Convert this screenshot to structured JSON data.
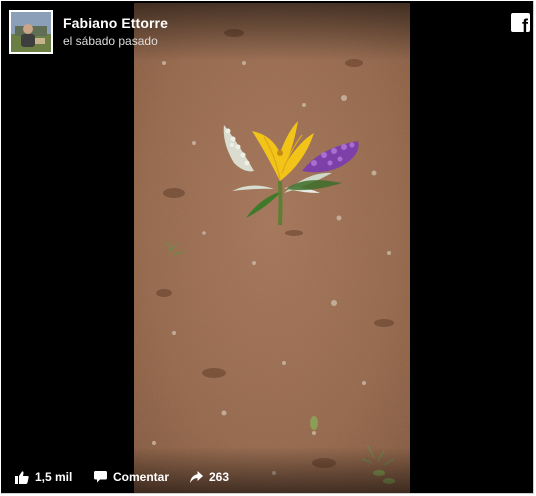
{
  "post": {
    "author": "Fabiano Ettorre",
    "timestamp": "el sábado pasado"
  },
  "actions": {
    "likes": "1,5 mil",
    "comment_label": "Comentar",
    "shares": "263"
  },
  "icons": {
    "brand": "facebook-icon",
    "like": "thumbs-up-icon",
    "comment": "speech-bubble-icon",
    "share": "share-arrow-icon"
  },
  "colors": {
    "background": "#000000",
    "soil": "#9a6a4a",
    "text": "#ffffff",
    "flower_yellow": "#f2c419",
    "flower_purple": "#7d3fa8"
  }
}
